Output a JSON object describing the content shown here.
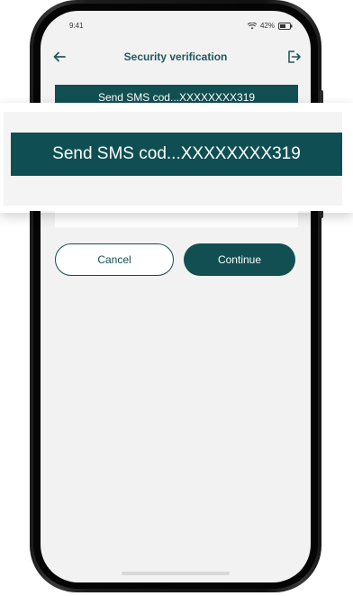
{
  "status_bar": {
    "time": "9:41",
    "battery": "42%"
  },
  "header": {
    "title": "Security verification"
  },
  "send_sms": {
    "label": "Send SMS cod...XXXXXXXX319"
  },
  "actions": {
    "cancel_label": "Cancel",
    "continue_label": "Continue"
  },
  "colors": {
    "primary": "#124f52",
    "title": "#23575f",
    "screen_bg": "#f2f2f2"
  },
  "icons": {
    "back": "arrow-left-icon",
    "logout": "logout-icon",
    "wifi": "wifi-icon",
    "battery": "battery-icon"
  }
}
